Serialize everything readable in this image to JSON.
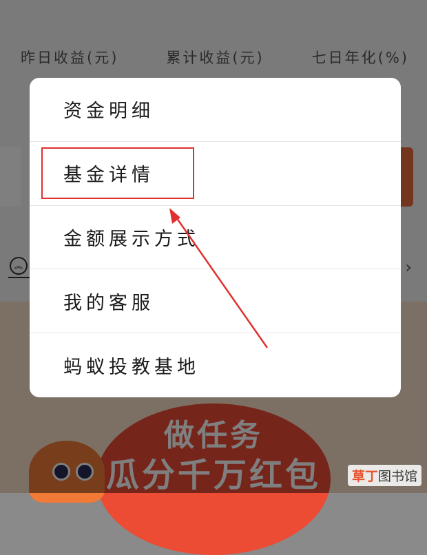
{
  "stats": {
    "yesterday_income_label": "昨日收益(元)",
    "total_income_label": "累计收益(元)",
    "seven_day_yield_label": "七日年化(%)"
  },
  "menu": {
    "items": [
      {
        "label": "资金明细"
      },
      {
        "label": "基金详情"
      },
      {
        "label": "金额展示方式"
      },
      {
        "label": "我的客服"
      },
      {
        "label": "蚂蚁投教基地"
      }
    ]
  },
  "promo": {
    "line1": "做任务",
    "line2": "瓜分千万红包"
  },
  "icons": {
    "collapse": "collapse-up-icon",
    "chevron": "chevron-right-icon"
  },
  "colors": {
    "annotation_red": "#e12f2f",
    "promo_red": "#ec4b34"
  },
  "watermark": {
    "accent": "草丁",
    "rest": "图书馆"
  }
}
